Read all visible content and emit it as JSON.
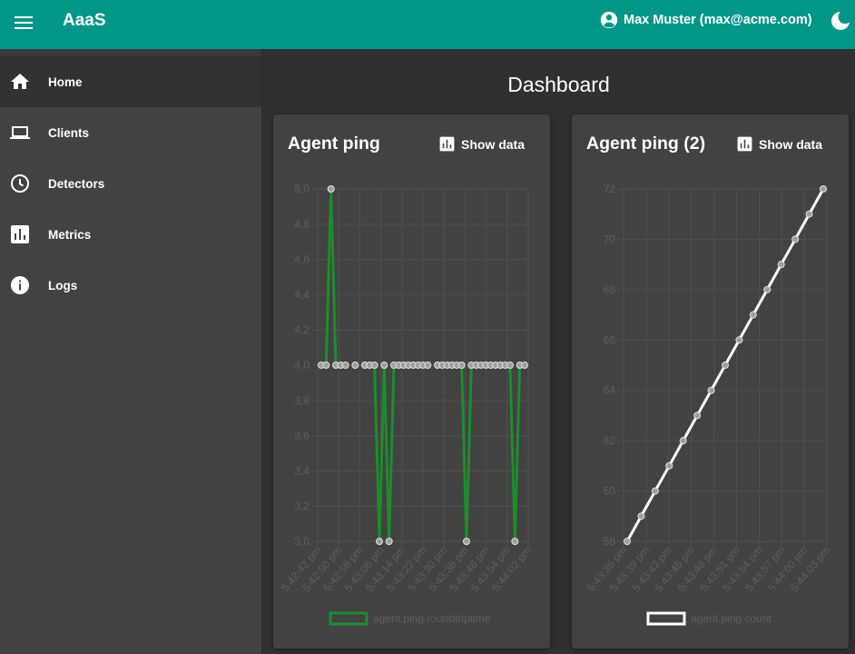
{
  "header": {
    "app_title": "AaaS",
    "user_label": "Max Muster (max@acme.com)",
    "menu_icon": "menu-icon",
    "user_icon": "account-circle-icon",
    "theme_icon": "moon-icon"
  },
  "colors": {
    "appbar": "#009688",
    "background": "#303030",
    "sidebar": "#424242",
    "card": "#424242",
    "series1": "#1e8c2e",
    "series2": "#ffffff"
  },
  "sidebar": {
    "items": [
      {
        "label": "Home",
        "icon": "home-icon",
        "active": true
      },
      {
        "label": "Clients",
        "icon": "laptop-icon",
        "active": false
      },
      {
        "label": "Detectors",
        "icon": "clock-icon",
        "active": false
      },
      {
        "label": "Metrics",
        "icon": "bar-chart-icon",
        "active": false
      },
      {
        "label": "Logs",
        "icon": "info-icon",
        "active": false
      }
    ]
  },
  "main": {
    "title": "Dashboard",
    "cards": [
      {
        "title": "Agent ping",
        "show_data_label": "Show data"
      },
      {
        "title": "Agent ping (2)",
        "show_data_label": "Show data"
      }
    ]
  },
  "chart_data": [
    {
      "type": "line",
      "title": "Agent ping",
      "ylim": [
        3.0,
        5.0
      ],
      "yticks": [
        "5,0",
        "4,8",
        "4,6",
        "4,4",
        "4,2",
        "4,0",
        "3,8",
        "3,6",
        "3,4",
        "3,2",
        "3,0"
      ],
      "xtick_labels": [
        "5:42:42 pm",
        "5:42:50 pm",
        "5:42:58 pm",
        "5:43:06 pm",
        "5:43:14 pm",
        "5:43:22 pm",
        "5:43:30 pm",
        "5:43:38 pm",
        "5:43:46 pm",
        "5:43:54 pm",
        "5:44:02 pm"
      ],
      "series": [
        {
          "name": "agent.ping.roundtriptime",
          "values": [
            4,
            4,
            5,
            4,
            4,
            4,
            null,
            4,
            null,
            4,
            4,
            4,
            3,
            4,
            3,
            4,
            4,
            4,
            4,
            4,
            4,
            4,
            4,
            null,
            4,
            4,
            4,
            4,
            4,
            4,
            3,
            4,
            4,
            4,
            4,
            4,
            4,
            4,
            4,
            4,
            3,
            4,
            4
          ]
        }
      ],
      "grid": true,
      "legend": "bottom"
    },
    {
      "type": "line",
      "title": "Agent ping (2)",
      "ylim": [
        58,
        72
      ],
      "yticks": [
        "72",
        "70",
        "68",
        "66",
        "64",
        "62",
        "60",
        "58"
      ],
      "xtick_labels": [
        "5:43:36 pm",
        "5:43:39 pm",
        "5:43:42 pm",
        "5:43:45 pm",
        "5:43:48 pm",
        "5:43:51 pm",
        "5:43:54 pm",
        "5:43:57 pm",
        "5:44:00 pm",
        "5:44:03 pm"
      ],
      "series": [
        {
          "name": "agent.ping.count",
          "values": [
            58,
            59,
            60,
            61,
            62,
            63,
            64,
            65,
            66,
            67,
            68,
            69,
            70,
            71,
            72
          ]
        }
      ],
      "grid": true,
      "legend": "bottom"
    }
  ]
}
